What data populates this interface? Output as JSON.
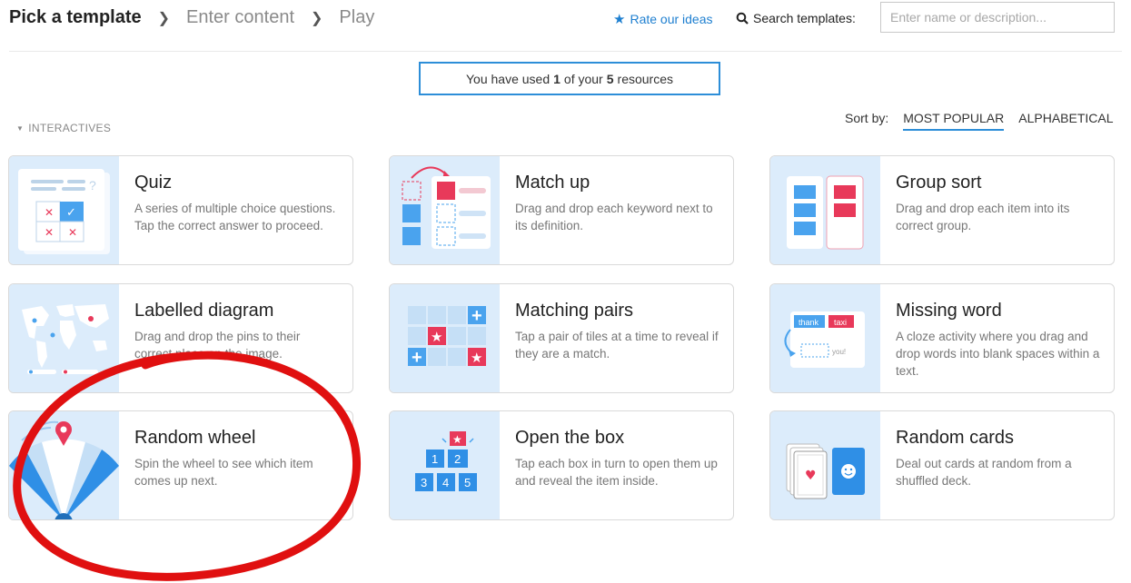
{
  "breadcrumb": {
    "steps": [
      "Pick a template",
      "Enter content",
      "Play"
    ]
  },
  "header": {
    "rate_label": "Rate our ideas",
    "search_label": "Search templates:",
    "search_placeholder": "Enter name or description..."
  },
  "quota": {
    "prefix": "You have used",
    "used": "1",
    "middle": "of your",
    "total": "5",
    "suffix": "resources"
  },
  "section": {
    "label": "INTERACTIVES"
  },
  "sort": {
    "label": "Sort by:",
    "options": [
      "MOST POPULAR",
      "ALPHABETICAL"
    ],
    "active": "MOST POPULAR"
  },
  "templates": [
    {
      "title": "Quiz",
      "desc": "A series of multiple choice questions. Tap the correct answer to proceed.",
      "icon": "quiz-icon"
    },
    {
      "title": "Match up",
      "desc": "Drag and drop each keyword next to its definition.",
      "icon": "match-up-icon"
    },
    {
      "title": "Group sort",
      "desc": "Drag and drop each item into its correct group.",
      "icon": "group-sort-icon"
    },
    {
      "title": "Labelled diagram",
      "desc": "Drag and drop the pins to their correct place on the image.",
      "icon": "world-map-icon"
    },
    {
      "title": "Matching pairs",
      "desc": "Tap a pair of tiles at a time to reveal if they are a match.",
      "icon": "matching-pairs-icon"
    },
    {
      "title": "Missing word",
      "desc": "A cloze activity where you drag and drop words into blank spaces within a text.",
      "icon": "missing-word-icon",
      "thumb_words": [
        "thank",
        "taxi",
        "you!"
      ]
    },
    {
      "title": "Random wheel",
      "desc": "Spin the wheel to see which item comes up next.",
      "icon": "random-wheel-icon"
    },
    {
      "title": "Open the box",
      "desc": "Tap each box in turn to open them up and reveal the item inside.",
      "icon": "open-the-box-icon",
      "thumb_numbers": [
        "1",
        "2",
        "3",
        "4",
        "5"
      ]
    },
    {
      "title": "Random cards",
      "desc": "Deal out cards at random from a shuffled deck.",
      "icon": "random-cards-icon"
    }
  ],
  "colors": {
    "accent": "#2d8ed8",
    "thumb_bg": "#dcecfb",
    "tile_blue": "#4aa3ee",
    "tile_pink": "#e8395a",
    "annotation_red": "#e01010"
  }
}
